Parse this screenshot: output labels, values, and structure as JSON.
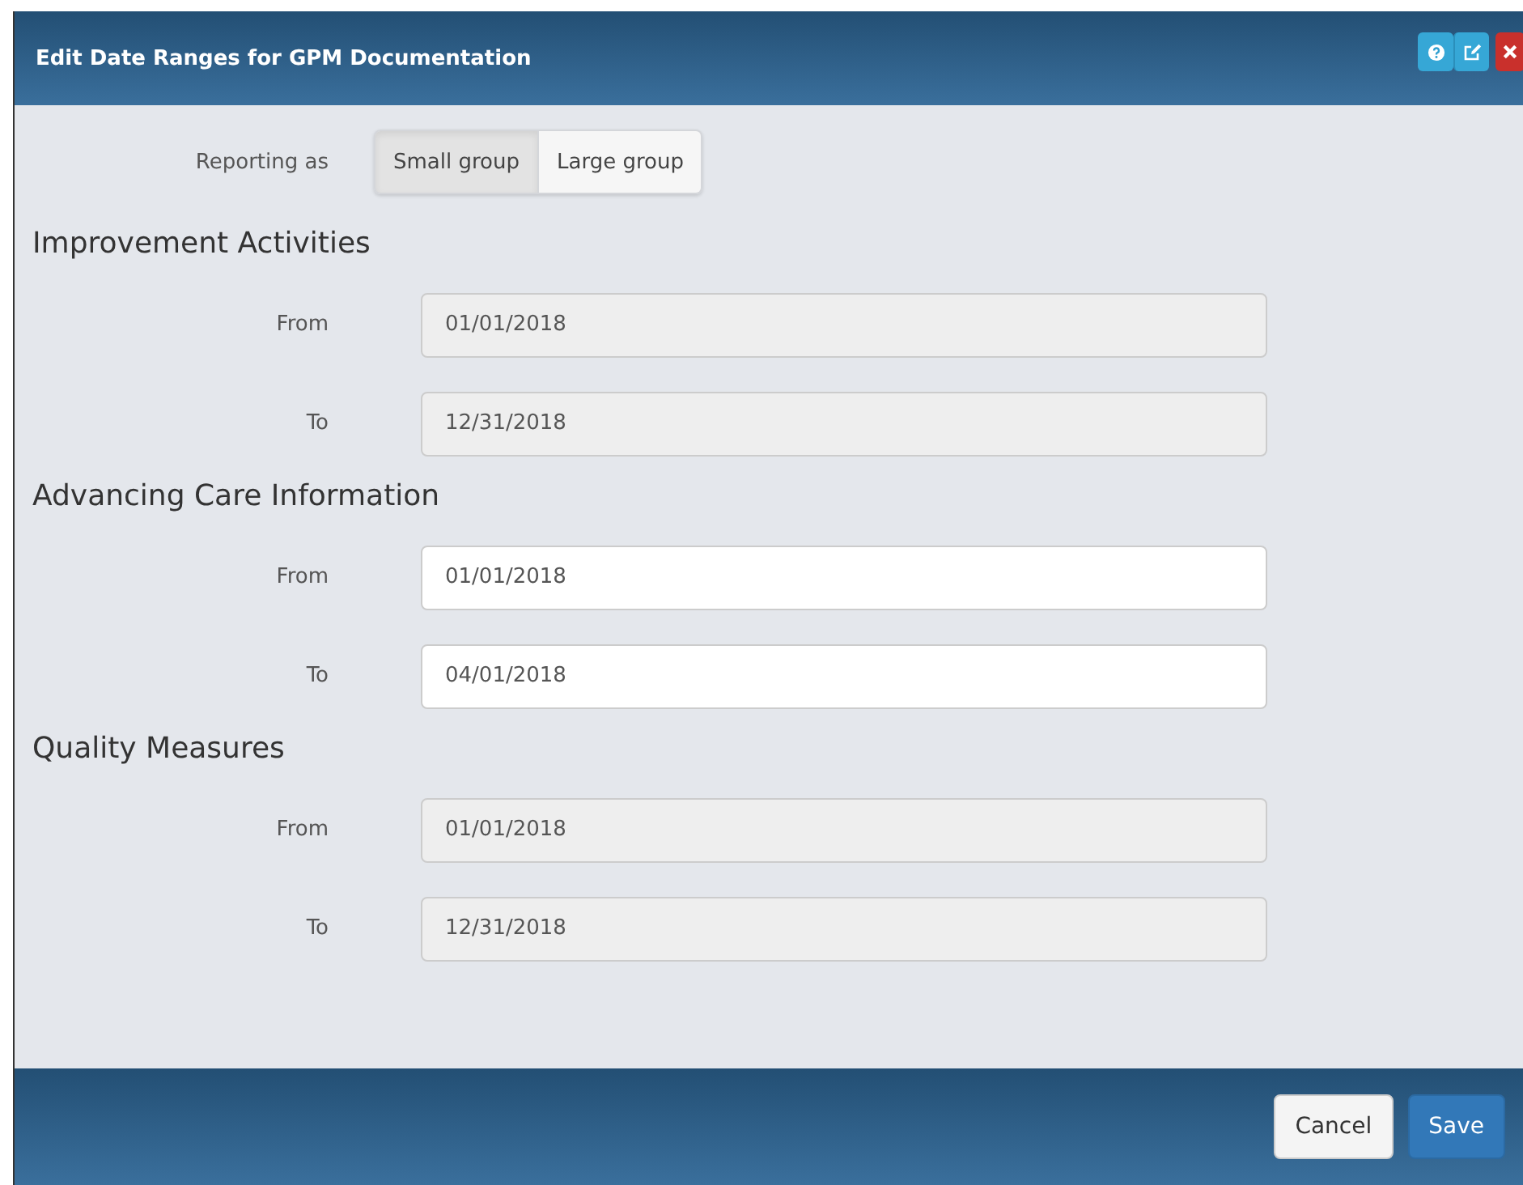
{
  "dialog": {
    "title": "Edit Date Ranges for GPM Documentation"
  },
  "header_buttons": [
    {
      "kind": "help"
    },
    {
      "kind": "edit"
    },
    {
      "kind": "close"
    }
  ],
  "reporting": {
    "label": "Reporting as",
    "options": [
      {
        "label": "Small group",
        "selected": true
      },
      {
        "label": "Large group",
        "selected": false
      }
    ]
  },
  "sections": [
    {
      "title": "Improvement Activities",
      "fields": [
        {
          "label": "From",
          "value": "01/01/2018",
          "disabled": true
        },
        {
          "label": "To",
          "value": "12/31/2018",
          "disabled": true
        }
      ]
    },
    {
      "title": "Advancing Care Information",
      "fields": [
        {
          "label": "From",
          "value": "01/01/2018",
          "disabled": false
        },
        {
          "label": "To",
          "value": "04/01/2018",
          "disabled": false
        }
      ]
    },
    {
      "title": "Quality Measures",
      "fields": [
        {
          "label": "From",
          "value": "01/01/2018",
          "disabled": true
        },
        {
          "label": "To",
          "value": "12/31/2018",
          "disabled": true
        }
      ]
    }
  ],
  "footer_buttons": [
    {
      "label": "Cancel",
      "kind": "default"
    },
    {
      "label": "Save",
      "kind": "primary"
    }
  ]
}
